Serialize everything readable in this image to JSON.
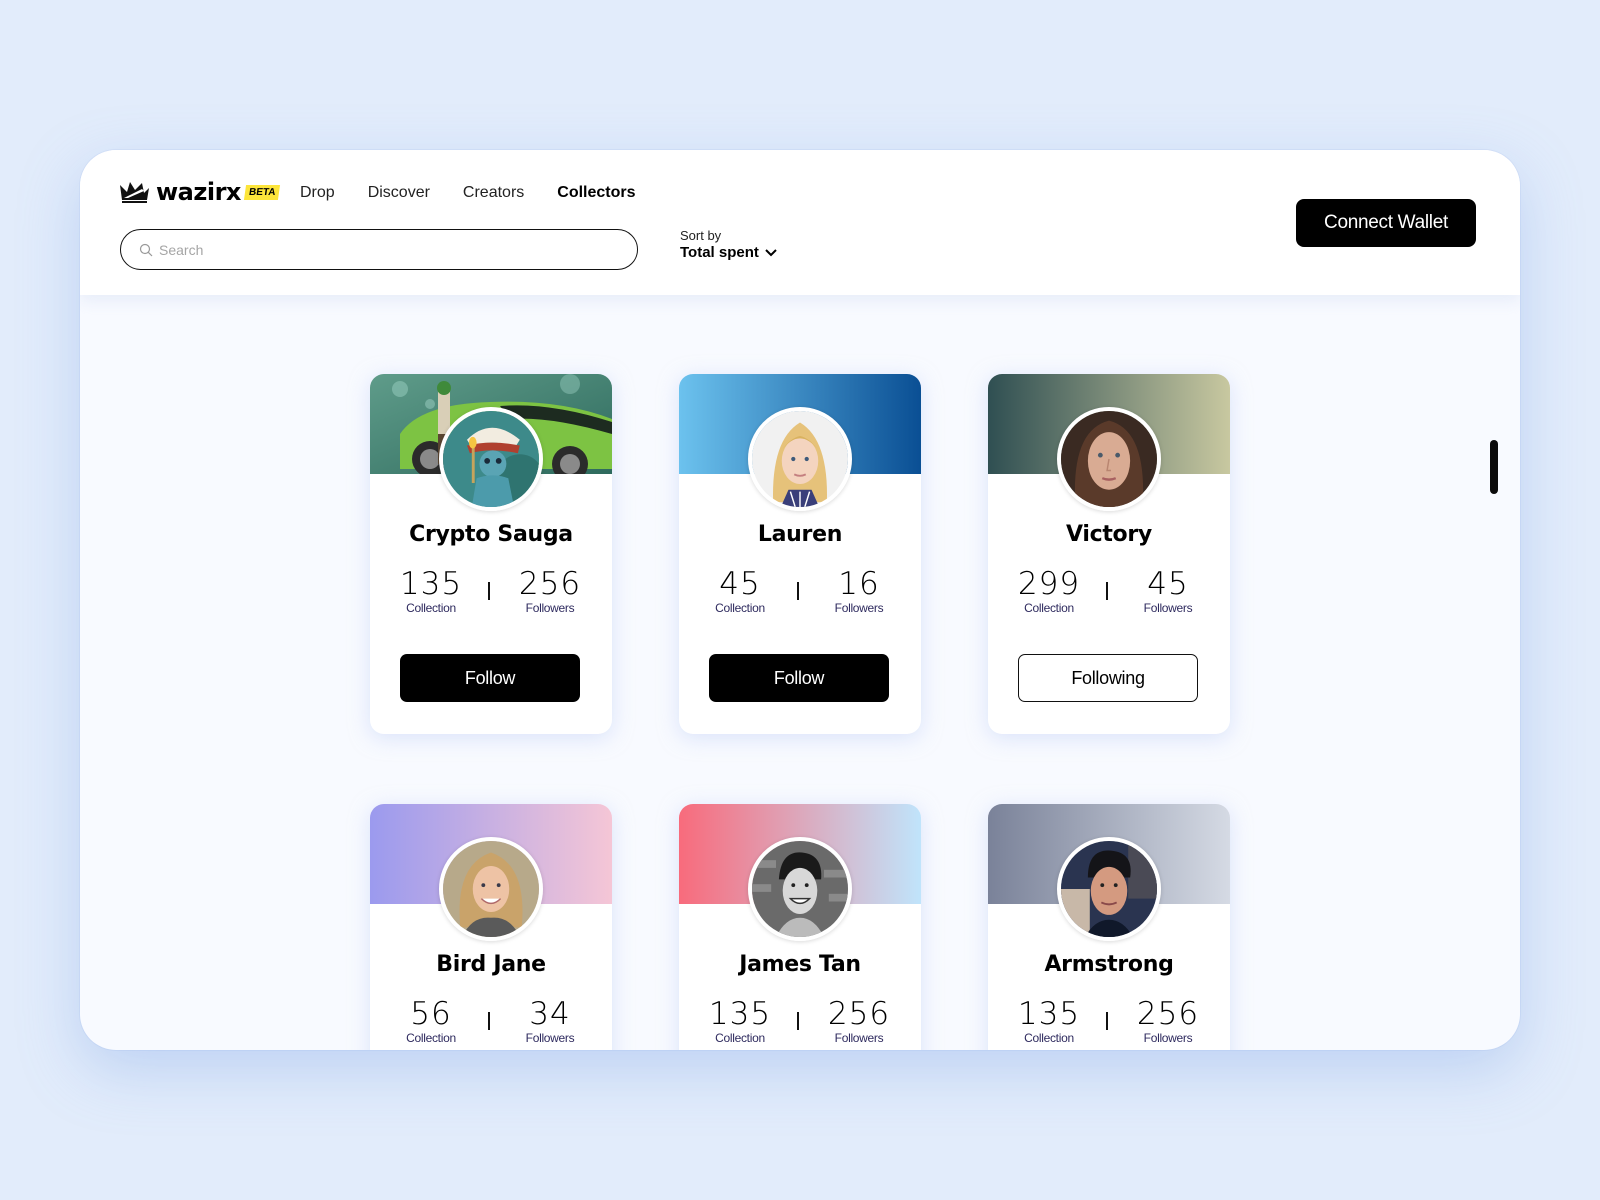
{
  "app": {
    "brand": "wazirx",
    "badge": "BETA"
  },
  "nav": {
    "items": [
      {
        "label": "Drop",
        "active": false
      },
      {
        "label": "Discover",
        "active": false
      },
      {
        "label": "Creators",
        "active": false
      },
      {
        "label": "Collectors",
        "active": true
      }
    ]
  },
  "search": {
    "placeholder": "Search",
    "value": ""
  },
  "sort": {
    "label": "Sort by",
    "value": "Total spent"
  },
  "header": {
    "connect_label": "Connect Wallet"
  },
  "collectors": [
    {
      "name": "Crypto Sauga",
      "collection": "135",
      "collection_label": "Collection",
      "followers": "256",
      "followers_label": "Followers",
      "button": "Follow",
      "following": false,
      "banner": "illustration-green-car",
      "banner_colors": [
        "#3f7a6c",
        "#6fb04a"
      ]
    },
    {
      "name": "Lauren",
      "collection": "45",
      "collection_label": "Collection",
      "followers": "16",
      "followers_label": "Followers",
      "button": "Follow",
      "following": false,
      "banner": "gradient",
      "banner_colors": [
        "#6cc2ee",
        "#0a4f94"
      ]
    },
    {
      "name": "Victory",
      "collection": "299",
      "collection_label": "Collection",
      "followers": "45",
      "followers_label": "Followers",
      "button": "Following",
      "following": true,
      "banner": "gradient",
      "banner_colors": [
        "#2f4f52",
        "#c8c8a0"
      ]
    },
    {
      "name": "Bird Jane",
      "collection": "56",
      "collection_label": "Collection",
      "followers": "34",
      "followers_label": "Followers",
      "banner": "gradient",
      "banner_colors": [
        "#9b9aee",
        "#f5c6d6"
      ]
    },
    {
      "name": "James Tan",
      "collection": "135",
      "collection_label": "Collection",
      "followers": "256",
      "followers_label": "Followers",
      "banner": "gradient",
      "banner_colors": [
        "#f86b7c",
        "#c0e4fb"
      ]
    },
    {
      "name": "Armstrong",
      "collection": "135",
      "collection_label": "Collection",
      "followers": "256",
      "followers_label": "Followers",
      "banner": "gradient",
      "banner_colors": [
        "#7a8299",
        "#d5dae4"
      ]
    }
  ],
  "colors": {
    "background": "#e2ecfb",
    "accent": "#000000",
    "beta_badge": "#fde53a",
    "stat_label": "#2e2a5e"
  }
}
